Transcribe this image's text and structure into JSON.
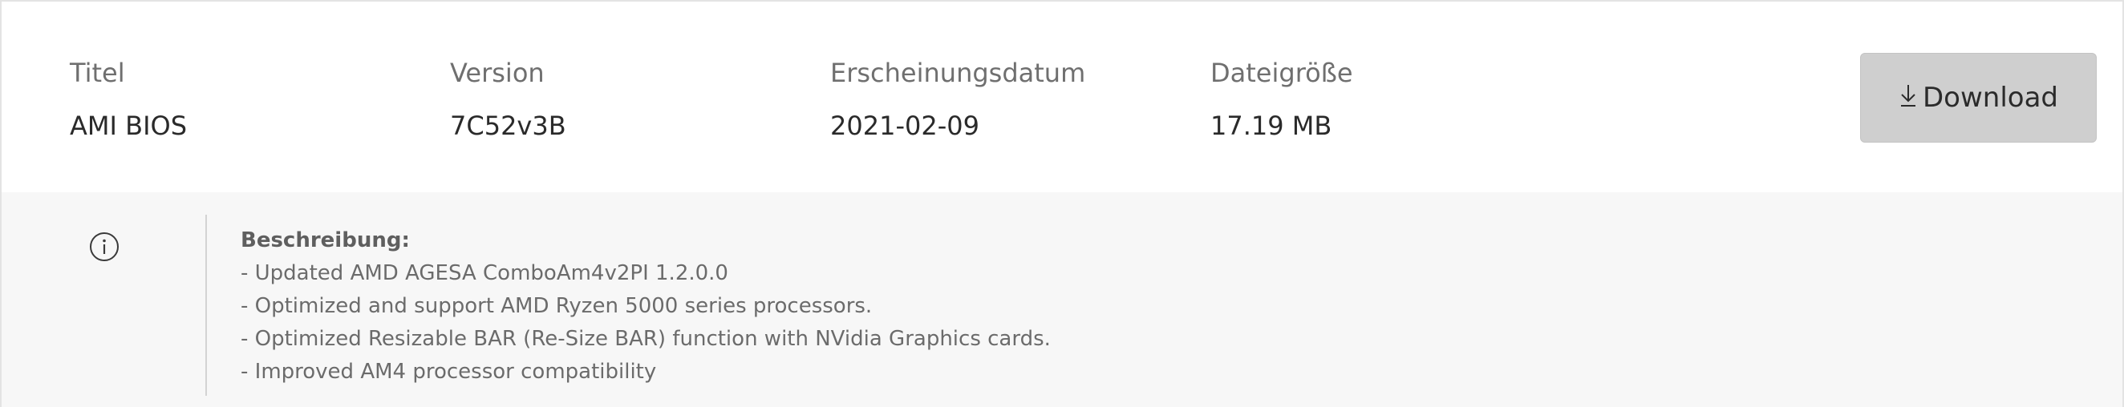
{
  "file": {
    "columns": [
      {
        "label": "Titel",
        "value": "AMI BIOS"
      },
      {
        "label": "Version",
        "value": "7C52v3B"
      },
      {
        "label": "Erscheinungsdatum",
        "value": "2021-02-09"
      },
      {
        "label": "Dateigröße",
        "value": "17.19 MB"
      }
    ],
    "download_label": "Download",
    "download_icon": "download-arrow-icon"
  },
  "description": {
    "heading": "Beschreibung:",
    "lines": [
      "- Updated AMD AGESA ComboAm4v2PI 1.2.0.0",
      "- Optimized and support AMD Ryzen 5000 series processors.",
      "- Optimized Resizable BAR (Re-Size BAR) function with NVidia Graphics cards.",
      "- Improved AM4 processor compatibility"
    ],
    "icon": "info-icon"
  },
  "colors": {
    "label": "#6f6f6f",
    "value": "#2a2a2a",
    "button_bg": "#cfcfcf",
    "panel_bg": "#f7f7f7"
  }
}
